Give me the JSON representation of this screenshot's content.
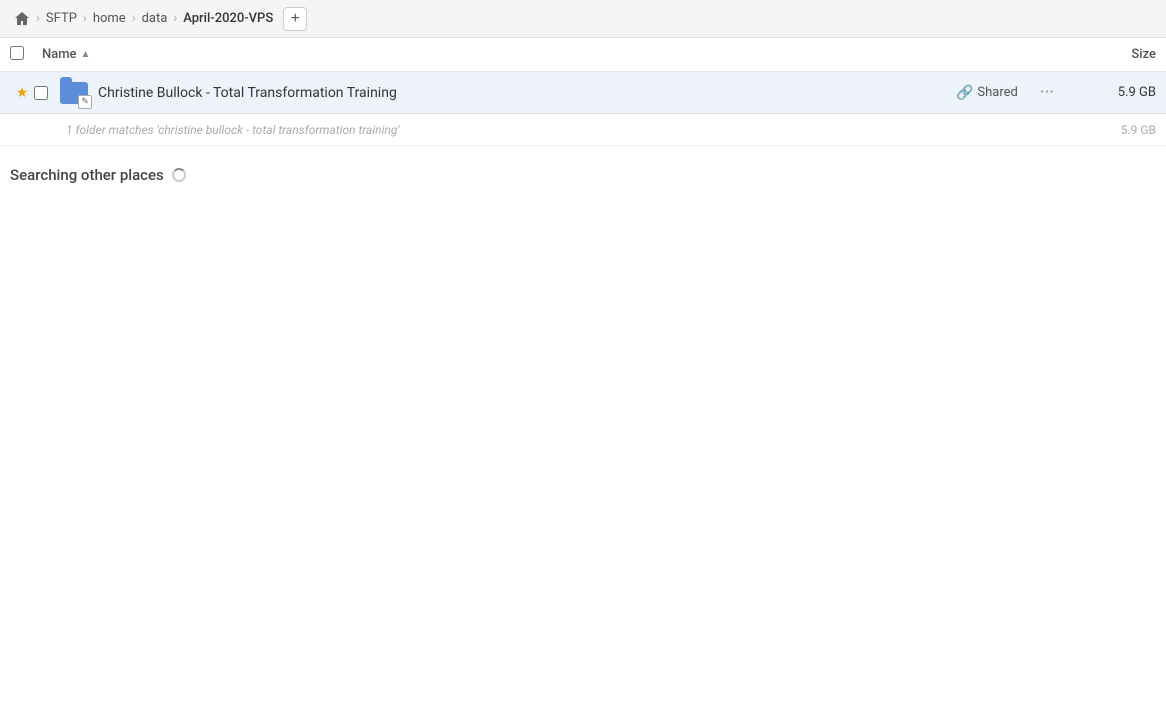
{
  "toolbar": {
    "home_icon": "🏠",
    "breadcrumbs": [
      {
        "label": "SFTP",
        "active": false
      },
      {
        "label": "home",
        "active": false
      },
      {
        "label": "data",
        "active": false
      },
      {
        "label": "April-2020-VPS",
        "active": true
      }
    ],
    "add_button_label": "+"
  },
  "columns": {
    "name_label": "Name",
    "sort_indicator": "▲",
    "size_label": "Size"
  },
  "file_row": {
    "name": "Christine Bullock - Total Transformation Training",
    "shared_label": "Shared",
    "size": "5.9 GB",
    "more_icon": "···"
  },
  "match_info": {
    "text": "1 folder matches 'christine bullock - total transformation training'",
    "size": "5.9 GB"
  },
  "searching_section": {
    "heading": "Searching other places"
  }
}
